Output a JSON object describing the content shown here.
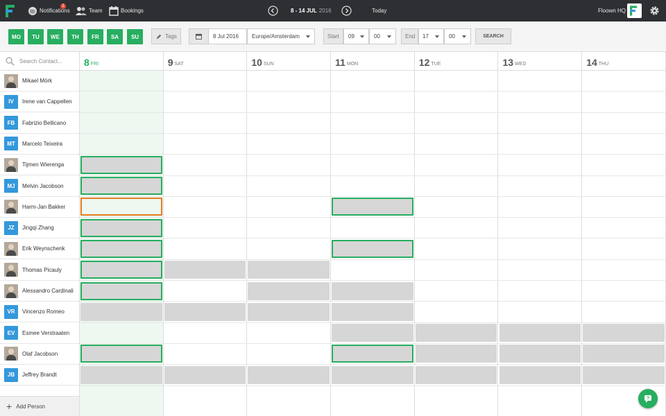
{
  "topbar": {
    "notifications_label": "Notifications",
    "notifications_count": "1",
    "team_label": "Team",
    "bookings_label": "Bookings",
    "date_range": "8 - 14 JUL",
    "date_year": "2016",
    "today_label": "Today",
    "org_name": "Floown HQ"
  },
  "toolbar": {
    "weekdays": [
      "MO",
      "TU",
      "WE",
      "TH",
      "FR",
      "SA",
      "SU"
    ],
    "tags_label": "Tags",
    "date_value": "8 Jul 2016",
    "timezone": "Europe/Amsterdam",
    "start_label": "Start",
    "start_hour": "09",
    "start_min": "00",
    "end_label": "End",
    "end_hour": "17",
    "end_min": "00",
    "search_label": "SEARCH"
  },
  "search": {
    "placeholder": "Search Contact..."
  },
  "days": [
    {
      "num": "8",
      "label": "FRI"
    },
    {
      "num": "9",
      "label": "SAT"
    },
    {
      "num": "10",
      "label": "SUN"
    },
    {
      "num": "11",
      "label": "MON"
    },
    {
      "num": "12",
      "label": "TUE"
    },
    {
      "num": "13",
      "label": "WED"
    },
    {
      "num": "14",
      "label": "THU"
    }
  ],
  "people": [
    {
      "name": "Mikael Mörk",
      "initials": ""
    },
    {
      "name": "Irene van Cappellen",
      "initials": "IV"
    },
    {
      "name": "Fabrizio Bellicano",
      "initials": "FB"
    },
    {
      "name": "Marcelo Teixeira",
      "initials": "MT"
    },
    {
      "name": "Tijmen Wierenga",
      "initials": ""
    },
    {
      "name": "Melvin Jacobson",
      "initials": "MJ"
    },
    {
      "name": "Harm-Jan Bakker",
      "initials": ""
    },
    {
      "name": "Jingqi Zhang",
      "initials": "JZ"
    },
    {
      "name": "Erik Weynschenk",
      "initials": ""
    },
    {
      "name": "Thomas Picauly",
      "initials": ""
    },
    {
      "name": "Alessandro Cardinali",
      "initials": ""
    },
    {
      "name": "Vincenzo Romeo",
      "initials": "VR"
    },
    {
      "name": "Esmee Verstraaten",
      "initials": "EV"
    },
    {
      "name": "Olaf Jacobson",
      "initials": ""
    },
    {
      "name": "Jeffrey Brandt",
      "initials": "JB"
    }
  ],
  "add_person_label": "Add Person",
  "bookings": [
    {
      "row": 4,
      "day": 0,
      "style": "selected"
    },
    {
      "row": 5,
      "day": 0,
      "style": "selected"
    },
    {
      "row": 6,
      "day": 0,
      "style": "conflict"
    },
    {
      "row": 6,
      "day": 3,
      "style": "selected"
    },
    {
      "row": 7,
      "day": 0,
      "style": "selected"
    },
    {
      "row": 8,
      "day": 0,
      "style": "selected"
    },
    {
      "row": 8,
      "day": 3,
      "style": "selected"
    },
    {
      "row": 9,
      "day": 0,
      "style": "selected"
    },
    {
      "row": 9,
      "day": 1,
      "style": "busy"
    },
    {
      "row": 9,
      "day": 2,
      "style": "busy"
    },
    {
      "row": 10,
      "day": 0,
      "style": "selected"
    },
    {
      "row": 10,
      "day": 2,
      "style": "busy"
    },
    {
      "row": 10,
      "day": 3,
      "style": "busy"
    },
    {
      "row": 11,
      "day": 0,
      "style": "busy"
    },
    {
      "row": 11,
      "day": 1,
      "style": "busy"
    },
    {
      "row": 11,
      "day": 2,
      "style": "busy"
    },
    {
      "row": 11,
      "day": 3,
      "style": "busy"
    },
    {
      "row": 12,
      "day": 3,
      "style": "busy"
    },
    {
      "row": 12,
      "day": 4,
      "style": "busy"
    },
    {
      "row": 12,
      "day": 5,
      "style": "busy"
    },
    {
      "row": 12,
      "day": 6,
      "style": "busy"
    },
    {
      "row": 13,
      "day": 0,
      "style": "selected"
    },
    {
      "row": 13,
      "day": 3,
      "style": "selected"
    },
    {
      "row": 13,
      "day": 4,
      "style": "busy"
    },
    {
      "row": 13,
      "day": 5,
      "style": "busy"
    },
    {
      "row": 13,
      "day": 6,
      "style": "busy"
    },
    {
      "row": 14,
      "day": 0,
      "style": "busy"
    },
    {
      "row": 14,
      "day": 1,
      "style": "busy"
    },
    {
      "row": 14,
      "day": 2,
      "style": "busy"
    },
    {
      "row": 14,
      "day": 3,
      "style": "busy"
    },
    {
      "row": 14,
      "day": 4,
      "style": "busy"
    },
    {
      "row": 14,
      "day": 5,
      "style": "busy"
    },
    {
      "row": 14,
      "day": 6,
      "style": "busy"
    }
  ],
  "colors": {
    "accent": "#27ae60",
    "topbar": "#2d2f33",
    "conflict": "#e67e22",
    "initials": "#3498db"
  }
}
